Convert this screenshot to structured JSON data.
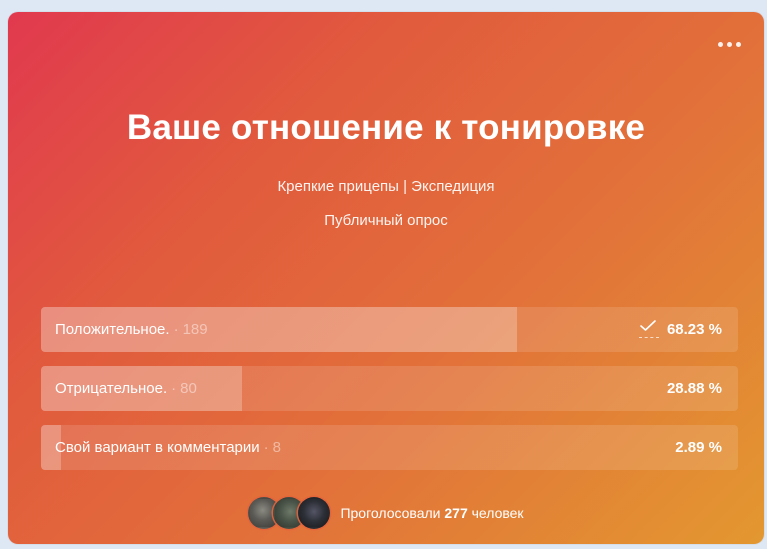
{
  "poll": {
    "title": "Ваше отношение к тонировке",
    "author": "Крепкие прицепы | Экспедиция",
    "type": "Публичный опрос",
    "options": [
      {
        "label": "Положительное.",
        "separator": "·",
        "count": "189",
        "percent_text": "68.23 %",
        "percent": 68.23,
        "voted": true
      },
      {
        "label": "Отрицательное.",
        "separator": "·",
        "count": "80",
        "percent_text": "28.88 %",
        "percent": 28.88,
        "voted": false
      },
      {
        "label": "Свой вариант в комментарии",
        "separator": "·",
        "count": "8",
        "percent_text": "2.89 %",
        "percent": 2.89,
        "voted": false
      }
    ],
    "footer": {
      "prefix": "Проголосовали",
      "count": "277",
      "suffix": "человек"
    }
  },
  "icons": {
    "more": "more-horizontal-icon",
    "check": "check-icon"
  },
  "colors": {
    "gradient_start": "#e1394f",
    "gradient_end": "#e39830"
  }
}
